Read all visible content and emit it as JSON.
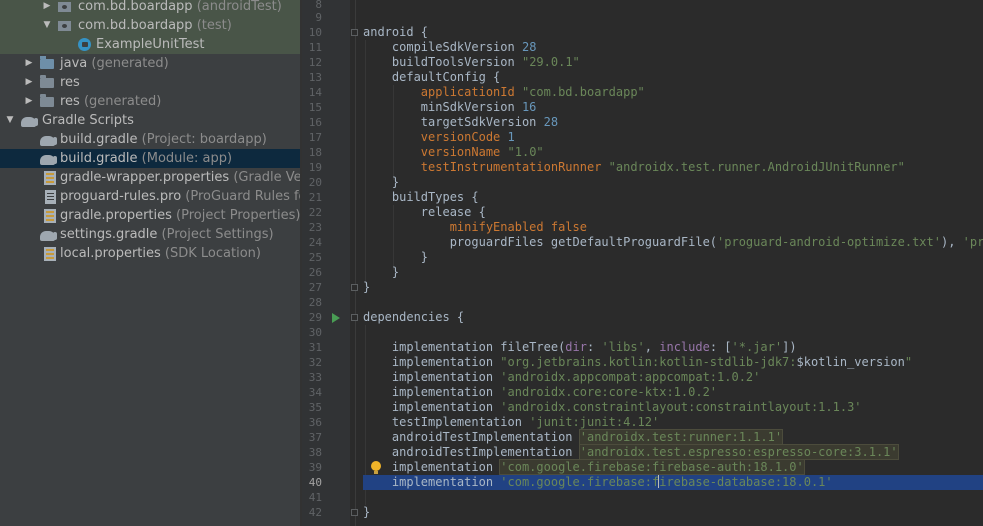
{
  "project_tree": {
    "items": [
      {
        "label": "com.bd.boardapp",
        "hint": "(androidTest)"
      },
      {
        "label": "com.bd.boardapp",
        "hint": "(test)"
      },
      {
        "label": "ExampleUnitTest",
        "hint": ""
      },
      {
        "label": "java",
        "hint": "(generated)"
      },
      {
        "label": "res",
        "hint": ""
      },
      {
        "label": "res",
        "hint": "(generated)"
      },
      {
        "label": "Gradle Scripts",
        "hint": ""
      },
      {
        "label": "build.gradle",
        "hint": "(Project: boardapp)"
      },
      {
        "label": "build.gradle",
        "hint": "(Module: app)"
      },
      {
        "label": "gradle-wrapper.properties",
        "hint": "(Gradle Version"
      },
      {
        "label": "proguard-rules.pro",
        "hint": "(ProGuard Rules fo"
      },
      {
        "label": "gradle.properties",
        "hint": "(Project Properties)"
      },
      {
        "label": "settings.gradle",
        "hint": "(Project Settings)"
      },
      {
        "label": "local.properties",
        "hint": "(SDK Location)"
      }
    ]
  },
  "editor": {
    "line_numbers": [
      "8",
      "9",
      "10",
      "11",
      "12",
      "13",
      "14",
      "15",
      "16",
      "17",
      "18",
      "19",
      "20",
      "21",
      "22",
      "23",
      "24",
      "25",
      "26",
      "27",
      "28",
      "29",
      "30",
      "31",
      "32",
      "33",
      "34",
      "35",
      "36",
      "37",
      "38",
      "39",
      "40",
      "41",
      "42"
    ],
    "current_line": "40",
    "code": {
      "l10": "android {",
      "l11_key": "compileSdkVersion",
      "l11_val": "28",
      "l12_key": "buildToolsVersion",
      "l12_val": "\"29.0.1\"",
      "l13": "defaultConfig {",
      "l14_key": "applicationId",
      "l14_val": "\"com.bd.boardapp\"",
      "l15_key": "minSdkVersion",
      "l15_val": "16",
      "l16_key": "targetSdkVersion",
      "l16_val": "28",
      "l17_key": "versionCode",
      "l17_val": "1",
      "l18_key": "versionName",
      "l18_val": "\"1.0\"",
      "l19_key": "testInstrumentationRunner",
      "l19_val": "\"androidx.test.runner.AndroidJUnitRunner\"",
      "l20": "}",
      "l21": "buildTypes {",
      "l22": "release {",
      "l23_key": "minifyEnabled",
      "l23_val": "false",
      "l24_a": "proguardFiles getDefaultProguardFile(",
      "l24_s1": "'proguard-android-optimize.txt'",
      "l24_b": "), ",
      "l24_s2": "'progu",
      "l25": "}",
      "l26": "}",
      "l27": "}",
      "l29": "dependencies {",
      "l31_a": "implementation fileTree(",
      "l31_k1": "dir",
      "l31_c1": ": ",
      "l31_s1": "'libs'",
      "l31_c2": ", ",
      "l31_k2": "include",
      "l31_c3": ": [",
      "l31_s2": "'*.jar'",
      "l31_c4": "])",
      "l32_a": "implementation ",
      "l32_s": "\"org.jetbrains.kotlin:kotlin-stdlib-jdk7:",
      "l32_v": "$kotlin_version",
      "l32_e": "\"",
      "l33_a": "implementation ",
      "l33_s": "'androidx.appcompat:appcompat:1.0.2'",
      "l34_a": "implementation ",
      "l34_s": "'androidx.core:core-ktx:1.0.2'",
      "l35_a": "implementation ",
      "l35_s": "'androidx.constraintlayout:constraintlayout:1.1.3'",
      "l36_a": "testImplementation ",
      "l36_s": "'junit:junit:4.12'",
      "l37_a": "androidTestImplementation ",
      "l37_s": "'androidx.test:runner:1.1.1'",
      "l38_a": "androidTestImplementation ",
      "l38_s": "'androidx.test.espresso:espresso-core:3.1.1'",
      "l39_a": "implementation ",
      "l39_s": "'com.google.firebase:firebase-auth:18.1.0'",
      "l40_a": "implementation ",
      "l40_s1": "'com.google.firebase:f",
      "l40_s2": "irebase-database:18.0.1'",
      "l42": "}"
    }
  },
  "colors": {
    "tree_bg": "#3c3f41",
    "editor_bg": "#2b2b2b",
    "gutter_bg": "#313335",
    "keyword": "#cc7832",
    "string": "#6a8759",
    "number": "#6897bb",
    "property": "#9876aa",
    "selection": "#214283"
  },
  "icons": {
    "tree": [
      "chevron-right-icon",
      "chevron-down-icon",
      "package-folder-icon",
      "kotlin-test-class-icon",
      "source-folder-icon",
      "resource-folder-icon",
      "gradle-elephant-icon",
      "properties-file-icon",
      "text-file-icon"
    ],
    "gutter": [
      "run-gutter-icon",
      "intention-bulb-icon",
      "fold-marker-icon"
    ]
  }
}
